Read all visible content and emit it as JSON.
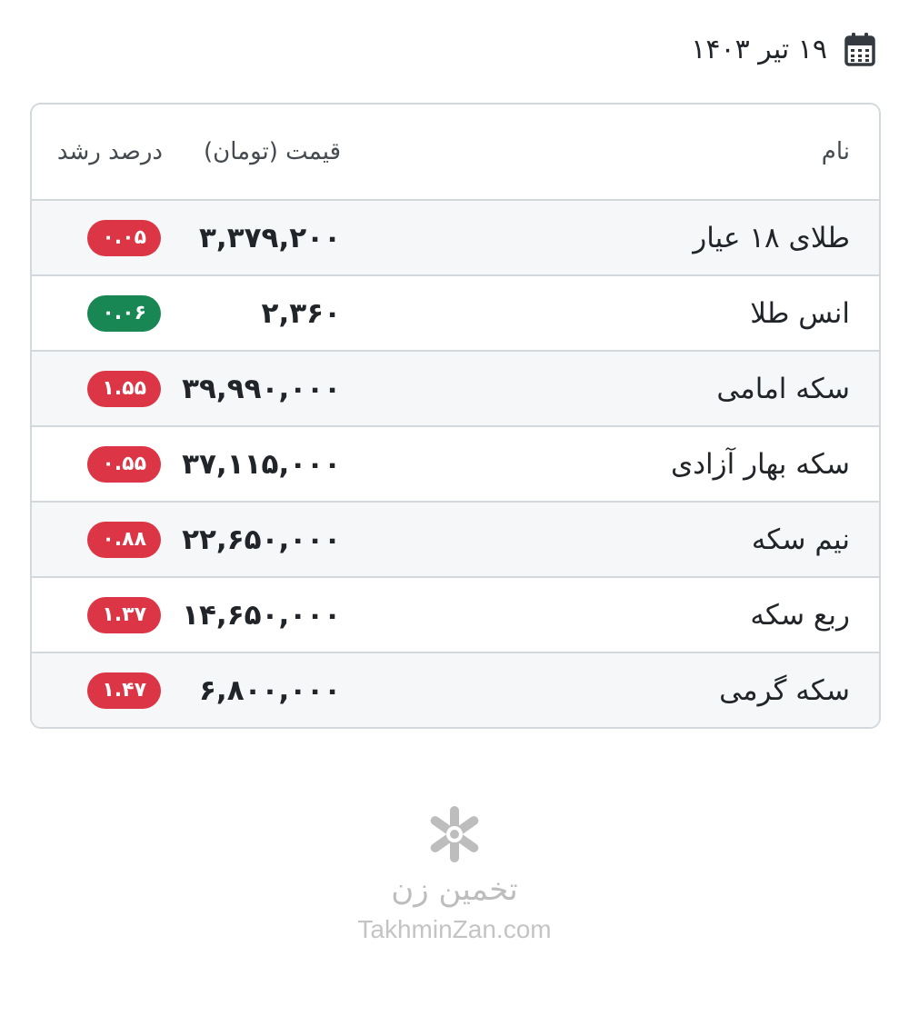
{
  "header": {
    "date": "۱۹ تیر ۱۴۰۳",
    "calendar_icon": "calendar-icon"
  },
  "table": {
    "columns": {
      "name": "نام",
      "price": "قیمت (تومان)",
      "growth": "درصد رشد"
    },
    "rows": [
      {
        "name": "طلای ۱۸ عیار",
        "price": "۳,۳۷۹,۲۰۰",
        "growth": "۰.۰۵",
        "direction": "down"
      },
      {
        "name": "انس طلا",
        "price": "۲,۳۶۰",
        "growth": "۰.۰۶",
        "direction": "up"
      },
      {
        "name": "سکه امامی",
        "price": "۳۹,۹۹۰,۰۰۰",
        "growth": "۱.۵۵",
        "direction": "down"
      },
      {
        "name": "سکه بهار آزادی",
        "price": "۳۷,۱۱۵,۰۰۰",
        "growth": "۰.۵۵",
        "direction": "down"
      },
      {
        "name": "نیم سکه",
        "price": "۲۲,۶۵۰,۰۰۰",
        "growth": "۰.۸۸",
        "direction": "down"
      },
      {
        "name": "ربع سکه",
        "price": "۱۴,۶۵۰,۰۰۰",
        "growth": "۱.۳۷",
        "direction": "down"
      },
      {
        "name": "سکه گرمی",
        "price": "۶,۸۰۰,۰۰۰",
        "growth": "۱.۴۷",
        "direction": "down"
      }
    ]
  },
  "footer": {
    "brand_fa": "تخمین زن",
    "brand_en": "TakhminZan.com",
    "logo_icon": "asterisk-logo-icon"
  },
  "colors": {
    "negative": "#dc3545",
    "positive": "#198754",
    "stripe": "#f5f7f9",
    "border": "#d3d8dd"
  }
}
